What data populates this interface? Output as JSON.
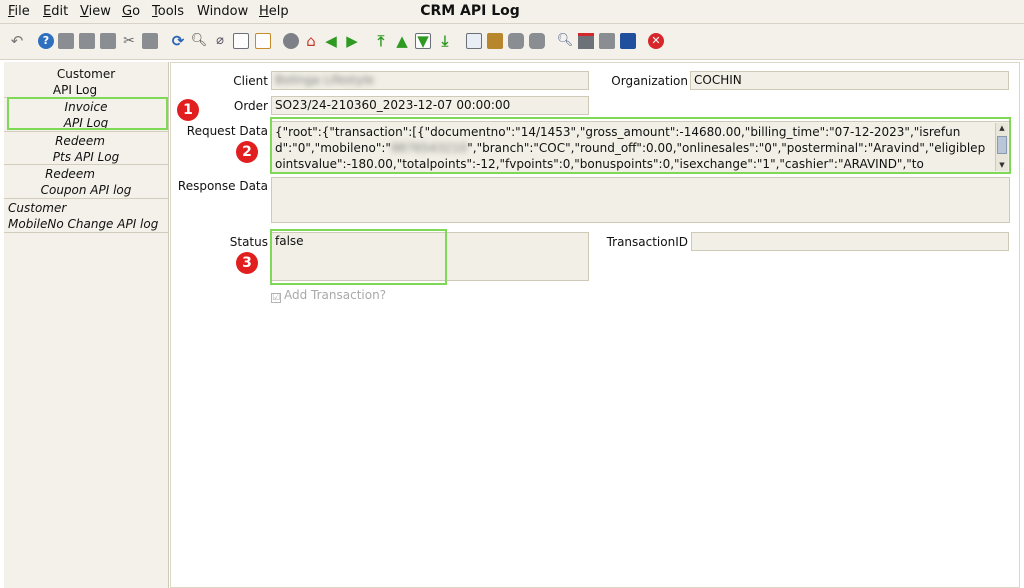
{
  "menu": {
    "items": [
      {
        "first": "F",
        "rest": "ile"
      },
      {
        "first": "E",
        "rest": "dit"
      },
      {
        "first": "V",
        "rest": "iew"
      },
      {
        "first": "G",
        "rest": "o"
      },
      {
        "first": "T",
        "rest": "ools"
      },
      {
        "first": "",
        "rest": "Window"
      },
      {
        "first": "H",
        "rest": "elp"
      }
    ]
  },
  "window": {
    "title": "CRM API Log"
  },
  "toolbar": {
    "icons": [
      "undo-icon",
      "help-icon",
      "new-icon",
      "copy-icon",
      "delete-icon",
      "delete-selection-icon",
      "save-icon",
      "refresh-icon",
      "find-icon",
      "attachment-icon",
      "chat-icon",
      "grid-toggle-icon",
      "history-icon",
      "home-icon",
      "back-icon",
      "forward-icon",
      "first-record-icon",
      "previous-record-icon",
      "next-record-icon",
      "last-record-icon",
      "report-icon",
      "archive-icon",
      "print-icon",
      "print-preview-icon",
      "zoom-icon",
      "workflow-icon",
      "product-icon",
      "lock-icon",
      "close-icon"
    ]
  },
  "sidebar": {
    "items": [
      {
        "line1": "Customer",
        "line2": "API Log"
      },
      {
        "line1": "Invoice",
        "line2": "API Log"
      },
      {
        "line1": "Redeem",
        "line2": "Pts API Log"
      },
      {
        "line1": "Redeem",
        "line2": "Coupon API log"
      },
      {
        "line1": "Customer",
        "line2": "MobileNo Change API log"
      }
    ]
  },
  "form": {
    "client_label": "Client",
    "client_value": "Bolinga Lifestyle",
    "organization_label": "Organization",
    "organization_value": "COCHIN",
    "order_label": "Order",
    "order_value": "SO23/24-210360_2023-12-07 00:00:00",
    "request_label": "Request Data",
    "request_value_1": "{\"root\":{\"transaction\":[{\"documentno\":\"14/1453\",\"gross_amount\":-14680.00,\"billing_time\":\"07-12-2023\",\"isrefund\":\"0\",\"mobileno\":\"",
    "request_value_masked": "9876543210",
    "request_value_2": "\",\"branch\":\"COC\",\"round_off\":0.00,\"onlinesales\":\"0\",\"posterminal\":\"Aravind\",\"eligiblepointsvalue\":-180.00,\"totalpoints\":-12,\"fvpoints\":0,\"bonuspoints\":0,\"isexchange\":\"1\",\"cashier\":\"ARAVIND\",\"to",
    "response_label": "Response Data",
    "response_value": "",
    "status_label": "Status",
    "status_value": "false",
    "transactionid_label": "TransactionID",
    "transactionid_value": "",
    "add_transaction_label": "Add Transaction?",
    "add_transaction_mark": "☑"
  },
  "annotations": {
    "badge1": "1",
    "badge2": "2",
    "badge3": "3"
  },
  "colors": {
    "highlight": "#7ed957",
    "badge": "#e21f1f",
    "field_bg": "#f2f0e6"
  }
}
